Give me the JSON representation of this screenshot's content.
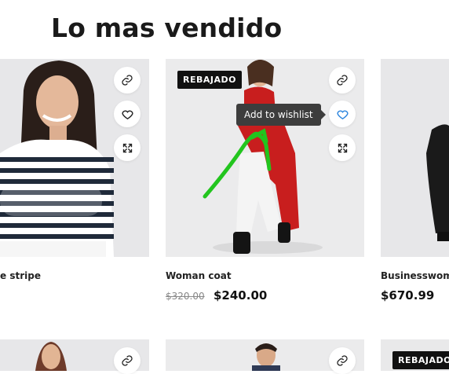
{
  "section": {
    "title": "Lo mas vendido"
  },
  "tooltip": {
    "text": "Add to wishlist"
  },
  "products": [
    {
      "name": "e stripe",
      "price": "",
      "old_price": ""
    },
    {
      "name": "Woman coat",
      "badge": "REBAJADO",
      "old_price": "$320.00",
      "price": "$240.00"
    },
    {
      "name": "Businesswoma",
      "price": "$670.99"
    }
  ],
  "second_row": {
    "badge": "REBAJADO"
  },
  "icons": {
    "link": "link-icon",
    "wishlist": "heart-icon",
    "quickview": "expand-icon"
  },
  "colors": {
    "badge_bg": "#111111",
    "wishlist_active": "#2e86de",
    "annotation_stroke": "#22c51e",
    "coat_red": "#c81e1e"
  }
}
